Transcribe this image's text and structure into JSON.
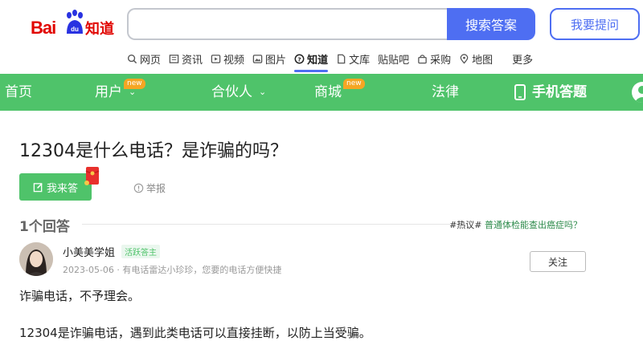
{
  "logo": {
    "bai": "Bai",
    "du": "du",
    "zhidao": "知道"
  },
  "search": {
    "value": "",
    "placeholder": "",
    "button": "搜索答案"
  },
  "ask_button": "我要提问",
  "subnav": [
    {
      "label": "网页",
      "icon": "search-icon"
    },
    {
      "label": "资讯",
      "icon": "news-icon"
    },
    {
      "label": "视频",
      "icon": "video-icon"
    },
    {
      "label": "图片",
      "icon": "image-icon"
    },
    {
      "label": "知道",
      "icon": "question-icon",
      "active": true
    },
    {
      "label": "文库",
      "icon": "doc-icon"
    },
    {
      "label": "贴贴吧",
      "icon": "tieba-icon"
    },
    {
      "label": "采购",
      "icon": "cart-icon"
    },
    {
      "label": "地图",
      "icon": "map-pin-icon"
    },
    {
      "label": "更多",
      "icon": ""
    }
  ],
  "greenbar": {
    "home": "首页",
    "users": "用户",
    "users_badge": "new",
    "partners": "合伙人",
    "mall": "商城",
    "mall_badge": "new",
    "law": "法律",
    "mobile": "手机答题"
  },
  "question": {
    "title": "12304是什么电话？是诈骗的吗？",
    "answer_button": "我来答",
    "report": "举报"
  },
  "answers": {
    "count": "1个回答",
    "hot_prefix": "#热议#",
    "hot_link": "普通体检能查出癌症吗？"
  },
  "answer": {
    "author": "小美美学姐",
    "tag": "活跃答主",
    "meta": "2023-05-06 · 有电话雷达小珍珍，您要的电话方便快捷",
    "follow": "关注",
    "paragraphs": [
      "诈骗电话，不予理会。",
      "12304是诈骗电话，遇到此类电话可以直接挂断，以防上当受骗。"
    ]
  },
  "colors": {
    "brand_blue": "#4e6ef2",
    "green": "#4fc36a",
    "baidu_red": "#e10602",
    "badge": "#f5a623"
  }
}
